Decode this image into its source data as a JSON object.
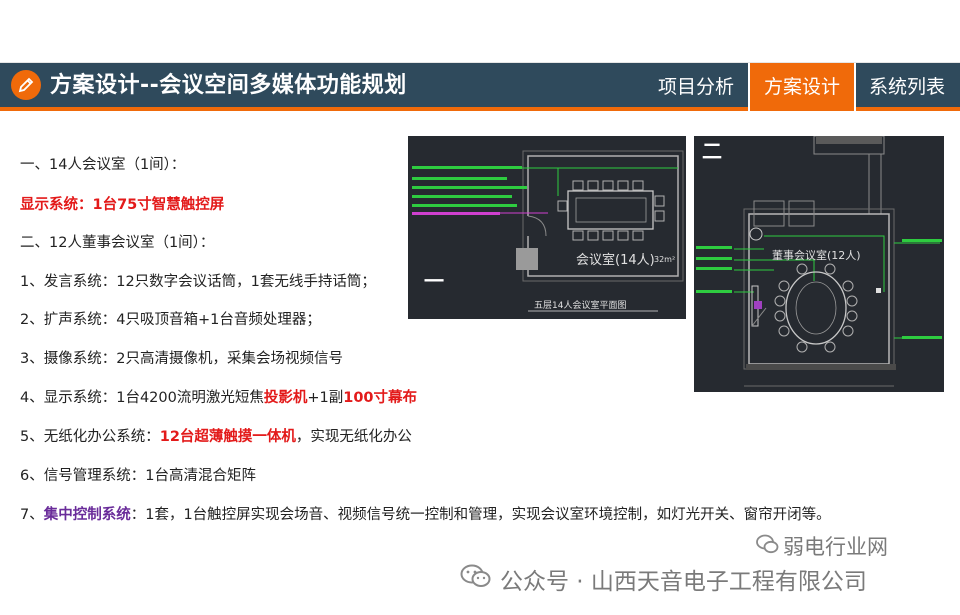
{
  "header": {
    "title": "方案设计--会议空间多媒体功能规划",
    "tabs": [
      {
        "label": "项目分析",
        "active": false
      },
      {
        "label": "方案设计",
        "active": true
      },
      {
        "label": "系统列表",
        "active": false
      }
    ],
    "logo_icon": "pencil-icon"
  },
  "content": {
    "room1_heading": "一、14人会议室（1间）：",
    "room1_display": "显示系统：1台75寸智慧触控屏",
    "room2_heading": "二、12人董事会议室（1间）：",
    "items": {
      "speech": "1、发言系统：12只数字会议话筒，1套无线手持话筒；",
      "sound": "2、扩声系统：4只吸顶音箱+1台音频处理器；",
      "camera": "3、摄像系统：2只高清摄像机，采集会场视频信号",
      "display_prefix": "4、显示系统：1台4200流明激光短焦",
      "display_projector": "投影机",
      "display_mid": "+1副",
      "display_screen": "100寸幕布",
      "paperless_prefix": "5、无纸化办公系统：",
      "paperless_highlight": "12台超薄触摸一体机",
      "paperless_suffix": "，实现无纸化办公",
      "signal": "6、信号管理系统：1台高清混合矩阵",
      "control_prefix": "7、",
      "control_highlight": "集中控制系统",
      "control_suffix": "：1套，1台触控屏实现会场音、视频信号统一控制和管理，实现会议室环境控制，如灯光开关、窗帘开闭等。"
    }
  },
  "figures": {
    "plan1": {
      "marker": "一",
      "room_label": "会议室(14人)",
      "area": "32m²",
      "caption": "五层14人会议室平面图"
    },
    "plan2": {
      "marker": "二",
      "room_label": "董事会议室(12人)"
    }
  },
  "watermarks": {
    "site": "弱电行业网",
    "account": "公众号 · 山西天音电子工程有限公司"
  },
  "colors": {
    "title_bar": "#2f4a5c",
    "accent": "#f06a0a",
    "highlight_red": "#e31a1a",
    "highlight_purple": "#6a2c9a",
    "cad_background": "#262a30"
  }
}
